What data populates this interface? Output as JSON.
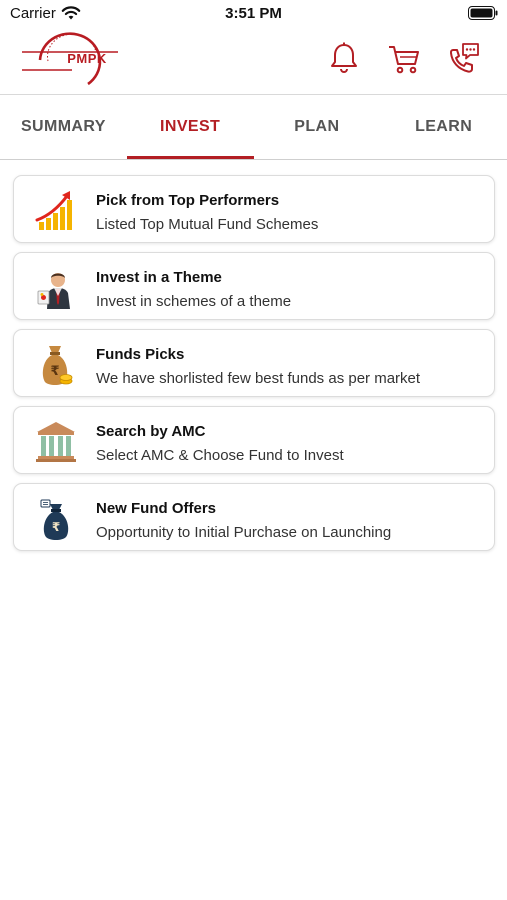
{
  "status_bar": {
    "carrier": "Carrier",
    "time": "3:51 PM"
  },
  "header": {
    "logo_text": "PMPK",
    "icons": [
      "bell-icon",
      "cart-icon",
      "phone-chat-icon"
    ]
  },
  "tabs": [
    {
      "label": "SUMMARY",
      "active": false
    },
    {
      "label": "INVEST",
      "active": true
    },
    {
      "label": "PLAN",
      "active": false
    },
    {
      "label": "LEARN",
      "active": false
    }
  ],
  "cards": [
    {
      "title": "Pick from Top Performers",
      "subtitle": "Listed Top Mutual Fund Schemes",
      "icon": "growth-chart-icon"
    },
    {
      "title": "Invest in a Theme",
      "subtitle": "Invest in schemes of a theme",
      "icon": "businessman-icon"
    },
    {
      "title": "Funds Picks",
      "subtitle": "We have shorlisted few best funds as per market",
      "icon": "money-bag-icon"
    },
    {
      "title": "Search by AMC",
      "subtitle": "Select AMC & Choose Fund to Invest",
      "icon": "bank-building-icon"
    },
    {
      "title": "New Fund Offers",
      "subtitle": "Opportunity to Initial Purchase on Launching",
      "icon": "rupee-bag-icon"
    }
  ],
  "colors": {
    "accent": "#b31f24",
    "tab_inactive": "#555555",
    "card_border": "#dcdcdc"
  }
}
